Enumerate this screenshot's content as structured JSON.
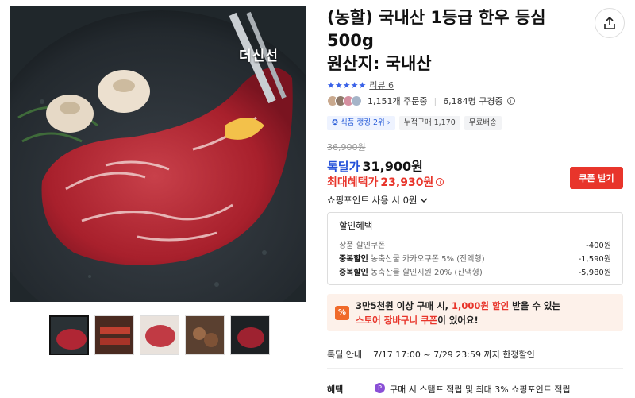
{
  "product": {
    "title": "(농할) 국내산 1등급 한우 등심\n500g\n원산지: 국내산",
    "watermark": "더신선",
    "rating_stars": "★★★★★",
    "review_label": "리뷰 6",
    "orders": "1,151개 주문중",
    "viewers": "6,184명 구경중",
    "badges": [
      "식품 랭킹 2위",
      "누적구매 1,170",
      "무료배송"
    ],
    "original_price": "36,900원",
    "deal_label": "톡딜가",
    "deal_price": "31,900원",
    "max_benefit_label": "최대혜택가",
    "max_benefit_price": "23,930원",
    "coupon_button": "쿠폰 받기",
    "points_label": "쇼핑포인트 사용 시 0원"
  },
  "discount": {
    "header": "할인혜택",
    "rows": [
      {
        "label": "",
        "desc": "상품 할인쿠폰",
        "amount": "-400원"
      },
      {
        "label": "중복할인",
        "desc": "농축산물 카카오쿠폰 5% (잔액형)",
        "amount": "-1,590원"
      },
      {
        "label": "중복할인",
        "desc": "농축산물 할인지원 20% (잔액형)",
        "amount": "-5,980원"
      }
    ]
  },
  "promo": {
    "icon": "%",
    "line1_pre": "3만5천원 이상 구매 시, ",
    "line1_red": "1,000원 할인",
    "line1_post": " 받을 수 있는",
    "line2_red": "스토어 장바구니 쿠폰",
    "line2_post": "이 있어요!"
  },
  "deal_info": {
    "key": "톡딜 안내",
    "value": "7/17 17:00 ~ 7/29 23:59 까지 한정할인"
  },
  "benefit": {
    "key": "혜택",
    "value": "구매 시 스탬프 적립 및 최대 3% 쇼핑포인트 적립"
  },
  "colors": {
    "accent_blue": "#2350d8",
    "accent_red": "#e8352b",
    "star": "#3a62e8"
  },
  "thumbnails": [
    "thumb-steak",
    "thumb-grill",
    "thumb-steak-2",
    "thumb-cooked",
    "thumb-steak-dark"
  ]
}
